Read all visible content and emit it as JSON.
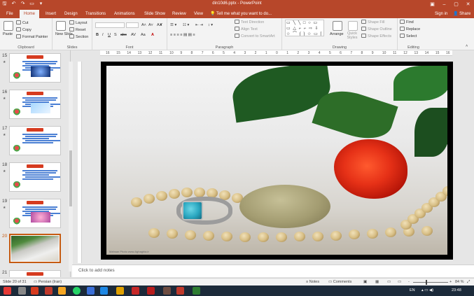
{
  "titlebar": {
    "title": "din10d6.pptx - PowerPoint",
    "qat": {
      "save": "🖫",
      "undo": "↶",
      "redo": "↷",
      "present": "▭",
      "more": "▾"
    },
    "controls": {
      "ribbon_options": "▣",
      "minimize": "–",
      "maximize": "▢",
      "close": "✕"
    }
  },
  "tabs": [
    "File",
    "Home",
    "Insert",
    "Design",
    "Transitions",
    "Animations",
    "Slide Show",
    "Review",
    "View"
  ],
  "tell_me": "Tell me what you want to do...",
  "account": {
    "signin": "Sign in",
    "share": "Share"
  },
  "ribbon": {
    "clipboard": {
      "label": "Clipboard",
      "paste": "Paste",
      "cut": "Cut",
      "copy": "Copy",
      "format_painter": "Format Painter"
    },
    "slides": {
      "label": "Slides",
      "new_slide": "New Slide",
      "layout": "Layout",
      "reset": "Reset",
      "section": "Section"
    },
    "font": {
      "label": "Font",
      "bold": "B",
      "italic": "I",
      "underline": "U",
      "strike": "S",
      "shadow": "abc",
      "spacing": "AV",
      "case": "Aa",
      "font_color": "A",
      "grow": "A˄",
      "shrink": "A˅",
      "clear": "A✘"
    },
    "paragraph": {
      "label": "Paragraph",
      "text_direction": "Text Direction",
      "align_text": "Align Text",
      "smartart": "Convert to SmartArt"
    },
    "drawing": {
      "label": "Drawing",
      "shapes": "▭ ╲ ╲ □ ○ ▭ ▭ △ ⌐ ⌐ ⇨ ⇩ ☆ ⌒ { } ☆ ▭ ⌈ ⌊ ⌒ ⌒ ⌒ ⌒",
      "arrange": "Arrange",
      "quick_styles": "Quick Styles",
      "shape_fill": "Shape Fill",
      "shape_outline": "Shape Outline",
      "shape_effects": "Shape Effects"
    },
    "editing": {
      "label": "Editing",
      "find": "Find",
      "replace": "Replace",
      "select": "Select"
    }
  },
  "ruler_ticks": [
    "16",
    "15",
    "14",
    "13",
    "12",
    "11",
    "10",
    "9",
    "8",
    "7",
    "6",
    "5",
    "4",
    "3",
    "2",
    "1",
    "0",
    "1",
    "2",
    "3",
    "4",
    "5",
    "6",
    "7",
    "8",
    "9",
    "10",
    "11",
    "12",
    "13",
    "14",
    "15",
    "16"
  ],
  "thumbnails": [
    {
      "num": "15",
      "star": "★"
    },
    {
      "num": "16",
      "star": "★"
    },
    {
      "num": "17",
      "star": "★"
    },
    {
      "num": "18",
      "star": "★"
    },
    {
      "num": "19",
      "star": "★"
    },
    {
      "num": "20",
      "star": ""
    },
    {
      "num": "21",
      "star": "★"
    }
  ],
  "slide": {
    "watermark": "Mahsan Photo  www.Aghaghia.ir"
  },
  "notes_placeholder": "Click to add notes",
  "status": {
    "slide_info": "Slide 20 of 31",
    "language": "Persian (Iran)",
    "notes": "Notes",
    "comments": "Comments",
    "zoom": "84 %",
    "zoom_minus": "-",
    "zoom_plus": "+"
  },
  "taskbar": {
    "language": "EN",
    "time": "23:48"
  },
  "colors": {
    "accent": "#b7472a",
    "ribbon_bg": "#f3f3f3",
    "taskbar": "#1c2a3a",
    "selected_thumb": "#c55a11"
  }
}
